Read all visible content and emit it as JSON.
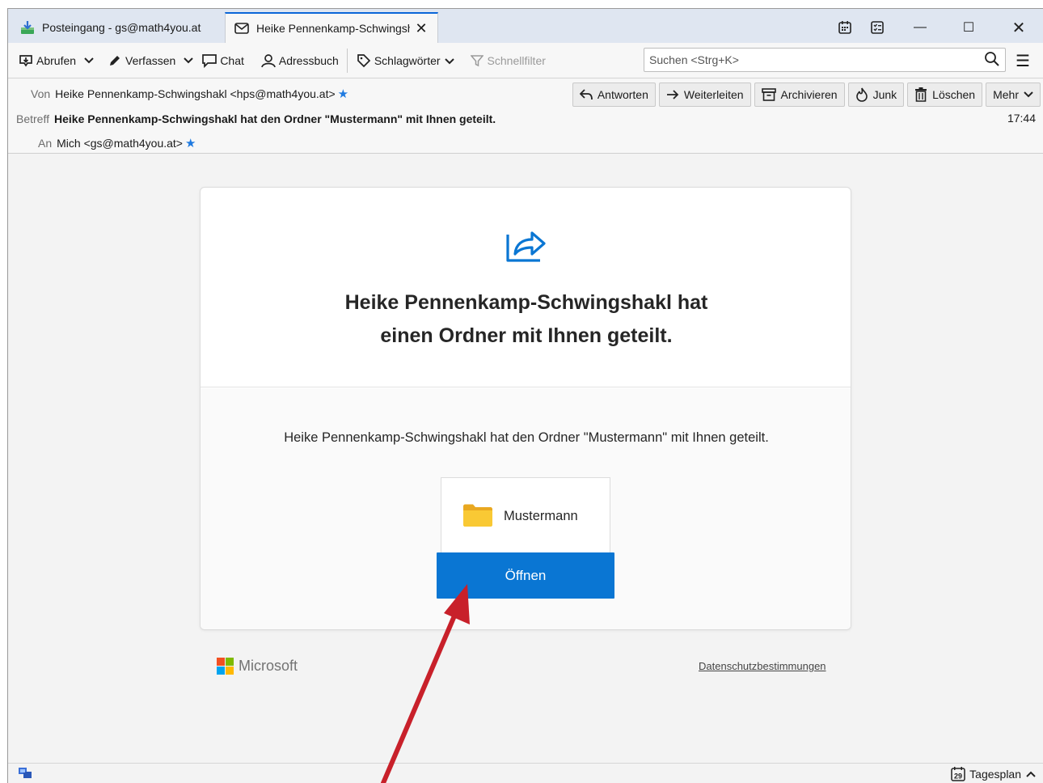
{
  "tabs": [
    {
      "label": "Posteingang - gs@math4you.at",
      "icon": "inbox-download-icon"
    },
    {
      "label": "Heike Pennenkamp-Schwingshakl",
      "icon": "envelope-icon",
      "close": "✕"
    }
  ],
  "toolbar": {
    "abrufen": "Abrufen",
    "verfassen": "Verfassen",
    "chat": "Chat",
    "adressbuch": "Adressbuch",
    "schlagwoerter": "Schlagwörter",
    "schnellfilter": "Schnellfilter",
    "search_placeholder": "Suchen <Strg+K>"
  },
  "header": {
    "from_label": "Von",
    "from_value": "Heike Pennenkamp-Schwingshakl <hps@math4you.at>",
    "subject_label": "Betreff",
    "subject_value": "Heike Pennenkamp-Schwingshakl hat den Ordner \"Mustermann\" mit Ihnen geteilt.",
    "to_label": "An",
    "to_value": "Mich <gs@math4you.at>",
    "time": "17:44",
    "actions": {
      "reply": "Antworten",
      "forward": "Weiterleiten",
      "archive": "Archivieren",
      "junk": "Junk",
      "delete": "Löschen",
      "more": "Mehr"
    }
  },
  "message": {
    "headline_line1": "Heike Pennenkamp-Schwingshakl hat",
    "headline_line2": "einen Ordner mit Ihnen geteilt.",
    "description": "Heike Pennenkamp-Schwingshakl hat den Ordner \"Mustermann\" mit Ihnen geteilt.",
    "folder_name": "Mustermann",
    "open_button": "Öffnen",
    "brand": "Microsoft",
    "privacy_link": "Datenschutzbestimmungen"
  },
  "statusbar": {
    "tagesplan": "Tagesplan",
    "calendar_day": "29"
  },
  "colors": {
    "accent_blue": "#0a76d3",
    "annotation_arrow": "#c8202a",
    "folder_yellow": "#f9c934"
  }
}
